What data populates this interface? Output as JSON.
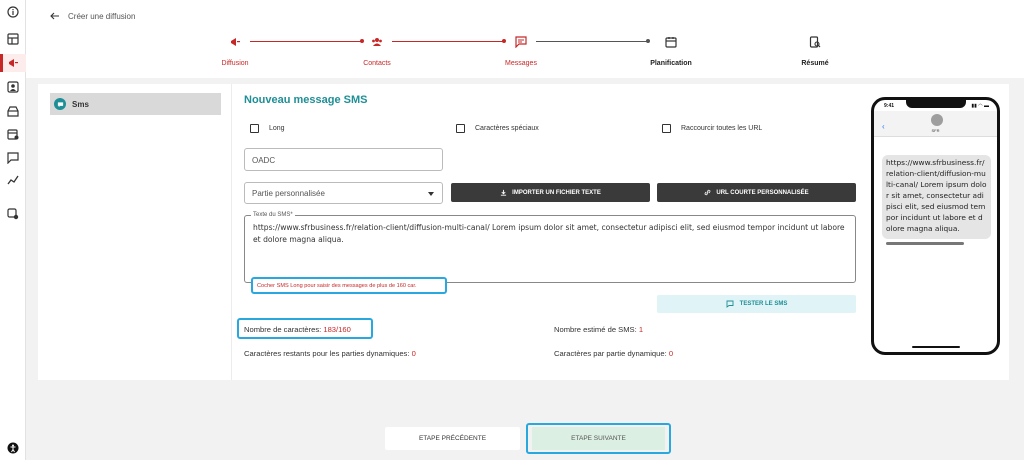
{
  "header": {
    "back_label": "Créer une diffusion",
    "steps": [
      {
        "label": "Diffusion",
        "icon": "megaphone-icon",
        "state": "done"
      },
      {
        "label": "Contacts",
        "icon": "contacts-icon",
        "state": "done"
      },
      {
        "label": "Messages",
        "icon": "message-icon",
        "state": "current"
      },
      {
        "label": "Planification",
        "icon": "calendar-icon",
        "state": "todo"
      },
      {
        "label": "Résumé",
        "icon": "summary-icon",
        "state": "todo"
      }
    ]
  },
  "sidebar": {
    "items": [
      {
        "label": "Sms",
        "icon": "sms-icon"
      }
    ]
  },
  "form": {
    "title": "Nouveau message SMS",
    "checkboxes": [
      {
        "label": "Long",
        "checked": false
      },
      {
        "label": "Caractères spéciaux",
        "checked": false
      },
      {
        "label": "Raccourcir toutes les URL",
        "checked": false
      }
    ],
    "oadc_placeholder": "OADC",
    "select_value": "Partie personnalisée",
    "import_button": "IMPORTER UN FICHIER TEXTE",
    "url_button": "URL COURTE PERSONNALISÉE",
    "textarea_label": "Texte du SMS*",
    "textarea_value": "https://www.sfrbusiness.fr/relation-client/diffusion-multi-canal/ Lorem ipsum dolor sit amet, consectetur adipisci elit, sed eiusmod tempor incidunt ut labore et dolore magna aliqua.",
    "warning": "Cocher SMS Long pour saisir des messages de plus de 160 car.",
    "test_button": "TESTER LE SMS"
  },
  "stats": {
    "char_count_label": "Nombre de caractères: ",
    "char_count_value": "183/160",
    "sms_estimate_label": "Nombre estimé de SMS: ",
    "sms_estimate_value": "1",
    "remaining_label": "Caractères restants pour les parties dynamiques: ",
    "remaining_value": "0",
    "per_part_label": "Caractères par partie dynamique: ",
    "per_part_value": "0"
  },
  "phone": {
    "time": "9:41",
    "status": "▮▮ ◠ ▬",
    "back": "‹",
    "contact_name": "SFR",
    "message": "https://www.sfrbusiness.fr/relation-client/diffusion-multi-canal/ Lorem ipsum dolor sit amet, consectetur adipisci elit, sed eiusmod tempor incidunt ut labore et dolore magna aliqua."
  },
  "footer": {
    "prev_label": "ETAPE PRÉCÉDENTE",
    "next_label": "ETAPE SUIVANTE"
  },
  "colors": {
    "accent_red": "#c62828",
    "teal": "#1e8f96",
    "highlight_blue": "#29a8e0"
  }
}
